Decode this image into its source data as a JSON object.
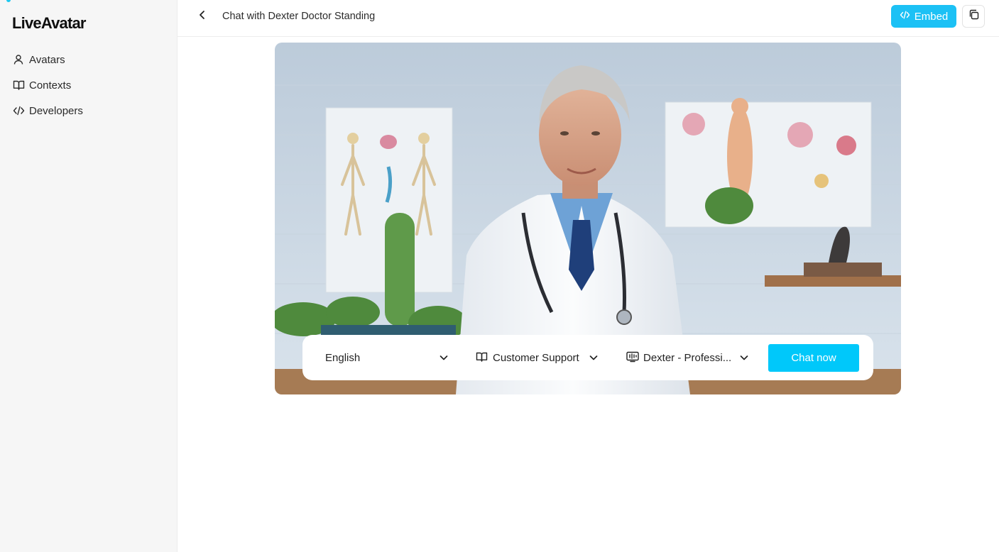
{
  "brand": {
    "name": "LiveAvatar",
    "accent": "#1cc1f5"
  },
  "sidebar": {
    "items": [
      {
        "label": "Avatars",
        "icon": "user-icon"
      },
      {
        "label": "Contexts",
        "icon": "book-open-icon"
      },
      {
        "label": "Developers",
        "icon": "code-icon"
      }
    ]
  },
  "header": {
    "title": "Chat with Dexter Doctor Standing",
    "embed_label": "Embed"
  },
  "controls": {
    "language": "English",
    "context": "Customer Support",
    "voice": "Dexter - Professi...",
    "chat_label": "Chat now"
  }
}
